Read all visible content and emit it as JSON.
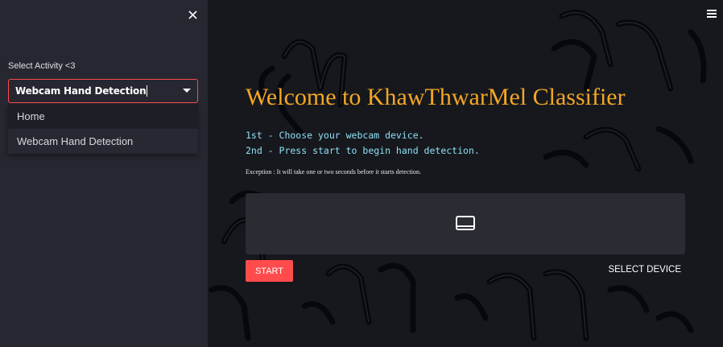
{
  "sidebar": {
    "close_icon": "close-icon",
    "select_label": "Select Activity <3",
    "selected_value": "Webcam Hand Detection",
    "options": [
      {
        "label": "Home"
      },
      {
        "label": "Webcam Hand Detection"
      }
    ]
  },
  "main": {
    "menu_icon": "hamburger-menu-icon",
    "title": "Welcome to KhawThwarMel Classifier",
    "step1": "1st - Choose your webcam device.",
    "step2": "2nd - Press start to begin hand detection.",
    "note": "Exception : It will take one or two seconds before it starts detection.",
    "video_icon": "monitor-icon",
    "start_label": "START",
    "select_device_label": "SELECT DEVICE"
  },
  "colors": {
    "accent": "#ff4b4b",
    "title": "#f5a623",
    "steps": "#8fe0f5",
    "sidebar_bg": "#262730",
    "main_bg": "#16181d"
  }
}
